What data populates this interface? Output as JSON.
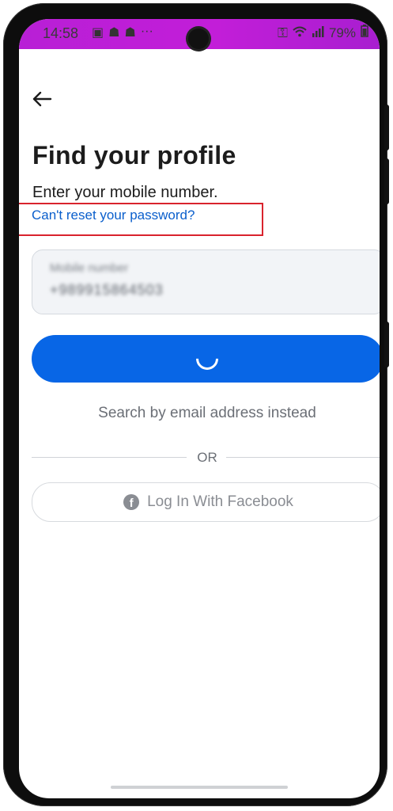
{
  "status_bar": {
    "time": "14:58",
    "battery": "79%",
    "left_icons": [
      "gallery-icon",
      "snapchat-icon",
      "snapchat-icon",
      "more-dots-icon"
    ],
    "right_icons": [
      "key-icon",
      "wifi-icon",
      "signal-icon",
      "battery-icon"
    ]
  },
  "header": {
    "title": "Find your profile",
    "subtitle": "Enter your mobile number.",
    "help_link": "Can't reset your password?"
  },
  "mobile_field": {
    "label": "Mobile number",
    "value": "+989915864503"
  },
  "primary_button": {
    "state": "loading"
  },
  "alt_search": {
    "label": "Search by email address instead"
  },
  "divider": {
    "label": "OR"
  },
  "facebook_button": {
    "label": "Log In With Facebook"
  },
  "colors": {
    "accent": "#0866e6",
    "link": "#0b5fcc",
    "status_bar": "#c21ed8",
    "annotation": "#d9232d"
  }
}
